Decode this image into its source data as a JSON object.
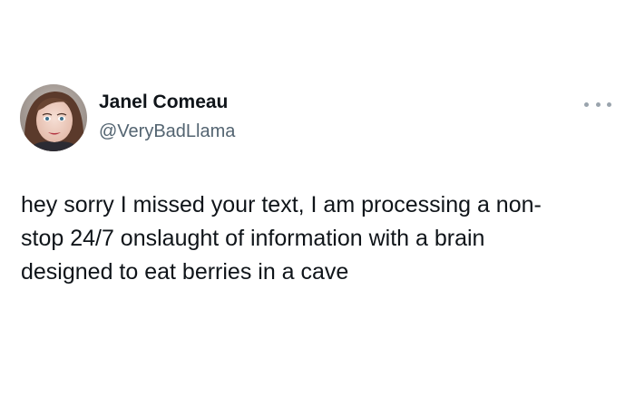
{
  "author": {
    "display_name": "Janel Comeau",
    "handle": "@VeryBadLlama",
    "avatar_icon": "profile-photo"
  },
  "more_menu_icon": "more-horizontal-icon",
  "tweet": {
    "lines": [
      "hey sorry I missed your text, I am processing a non-",
      "stop 24/7 onslaught of information with a brain",
      "designed to eat berries in a cave"
    ]
  },
  "colors": {
    "text_primary": "#0f1419",
    "text_secondary": "#536471",
    "more_dots": "#9aa4ad",
    "background": "#ffffff"
  }
}
